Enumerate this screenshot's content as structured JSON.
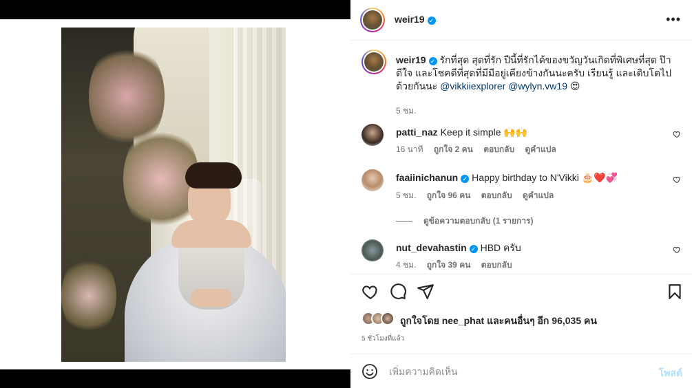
{
  "post": {
    "username": "weir19",
    "verified": true
  },
  "caption": {
    "username": "weir19",
    "text": "รักที่สุด สุดที่รัก ปีนี้ที่รักได้ของขวัญวันเกิดที่พิเศษที่สุด ป๊าดีใจ และโชคดีที่สุดที่มีมือยู่เคียงข้างกันนะครับ เรียนรู้ และเติบโตไปด้วยกันนะ",
    "mention1": "@vikkiiexplorer",
    "mention2": "@wylyn.vw19",
    "emoji": "😍",
    "time": "5 ชม."
  },
  "comments": [
    {
      "username": "patti_naz",
      "verified": false,
      "text": "Keep it simple 🙌🙌",
      "time": "16 นาที",
      "likes": "ถูกใจ 2 คน",
      "reply": "ตอบกลับ",
      "translate": "ดูคำแปล"
    },
    {
      "username": "faaiinichanun",
      "verified": true,
      "text": "Happy birthday to N'Vikki 🎂❤️💞",
      "time": "5 ชม.",
      "likes": "ถูกใจ 96 คน",
      "reply": "ตอบกลับ",
      "translate": "ดูคำแปล"
    },
    {
      "username": "nut_devahastin",
      "verified": true,
      "text": "HBD ครับ",
      "time": "4 ชม.",
      "likes": "ถูกใจ 39 คน",
      "reply": "ตอบกลับ"
    }
  ],
  "view_replies": "ดูข้อความตอบกลับ (1 รายการ)",
  "likes": {
    "prefix": "ถูกใจโดย",
    "user": "nee_phat",
    "suffix": "และคนอื่นๆ อีก 96,035 คน"
  },
  "posted_time": "5 ชั่วโมงที่แล้ว",
  "add_comment": {
    "placeholder": "เพิ่มความคิดเห็น",
    "post_label": "โพสต์"
  },
  "icons": {
    "more": "more-horizontal-icon",
    "like": "heart-icon",
    "comment": "comment-icon",
    "share": "send-icon",
    "save": "bookmark-icon",
    "emoji": "emoji-icon"
  },
  "colors": {
    "verified": "#0095f6",
    "link": "#00376b",
    "post_button": "#b2dffc",
    "secondary_text": "#737373"
  }
}
